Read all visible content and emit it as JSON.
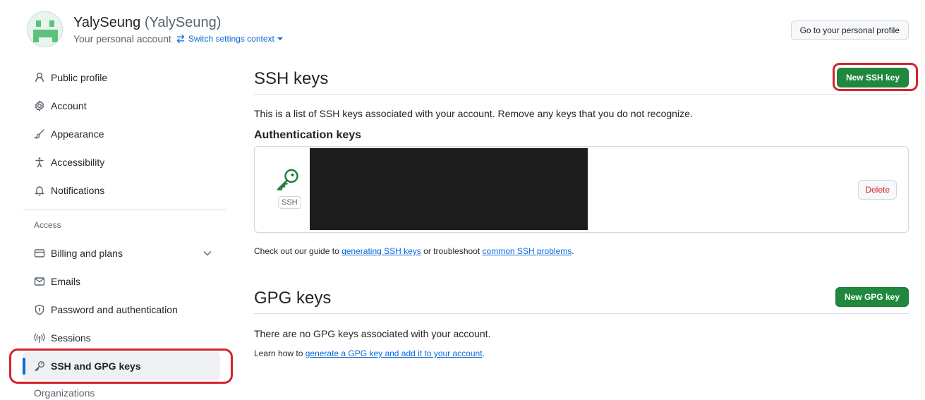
{
  "header": {
    "user_name": "YalySeung",
    "user_handle": "(YalySeung)",
    "account_type": "Your personal account",
    "switch_context": "Switch settings context",
    "profile_button": "Go to your personal profile"
  },
  "sidebar": {
    "items": [
      {
        "label": "Public profile",
        "icon": "person-icon"
      },
      {
        "label": "Account",
        "icon": "gear-icon"
      },
      {
        "label": "Appearance",
        "icon": "paintbrush-icon"
      },
      {
        "label": "Accessibility",
        "icon": "accessibility-icon"
      },
      {
        "label": "Notifications",
        "icon": "bell-icon"
      }
    ],
    "access_heading": "Access",
    "access_items": [
      {
        "label": "Billing and plans",
        "icon": "credit-card-icon"
      },
      {
        "label": "Emails",
        "icon": "mail-icon"
      },
      {
        "label": "Password and authentication",
        "icon": "shield-icon"
      },
      {
        "label": "Sessions",
        "icon": "broadcast-icon"
      },
      {
        "label": "SSH and GPG keys",
        "icon": "key-icon"
      }
    ],
    "cut_item": "Organizations"
  },
  "ssh": {
    "title": "SSH keys",
    "new_button": "New SSH key",
    "description": "This is a list of SSH keys associated with your account. Remove any keys that you do not recognize.",
    "auth_heading": "Authentication keys",
    "key_type": "SSH",
    "delete_button": "Delete",
    "guide_prefix": "Check out our guide to ",
    "guide_link1": "generating SSH keys",
    "guide_middle": " or troubleshoot ",
    "guide_link2": "common SSH problems",
    "guide_suffix": "."
  },
  "gpg": {
    "title": "GPG keys",
    "new_button": "New GPG key",
    "empty_note": "There are no GPG keys associated with your account.",
    "learn_prefix": "Learn how to ",
    "learn_link": "generate a GPG key and add it to your account",
    "learn_suffix": "."
  },
  "colors": {
    "accent": "#0969da",
    "primary_button": "#1f883d",
    "danger": "#d1242f",
    "highlight_annotation": "#d1242f"
  }
}
